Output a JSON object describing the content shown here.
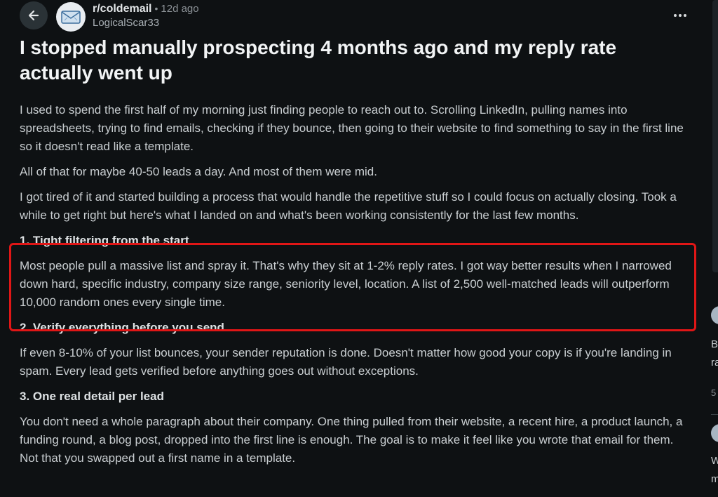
{
  "header": {
    "subreddit": "r/coldemail",
    "separator": "•",
    "time_ago": "12d ago",
    "author": "LogicalScar33",
    "back_icon": "arrow-left-icon",
    "more_icon": "more-horizontal-icon"
  },
  "post": {
    "title": "I stopped manually prospecting 4 months ago and my reply rate actually went up",
    "para1": "I used to spend the first half of my morning just finding people to reach out to. Scrolling LinkedIn, pulling names into spreadsheets, trying to find emails, checking if they bounce, then going to their website to find something to say in the first line so it doesn't read like a template.",
    "para2": "All of that for maybe 40-50 leads a day. And most of them were mid.",
    "para3": "I got tired of it and started building a process that would handle the repetitive stuff so I could focus on actually closing. Took a while to get right but here's what I landed on and what's been working consistently for the last few months.",
    "section1": {
      "heading": "1. Tight filtering from the start",
      "text": "Most people pull a massive list and spray it. That's why they sit at 1-2% reply rates. I got way better results when I narrowed down hard, specific industry, company size range, seniority level, location. A list of 2,500 well-matched leads will outperform 10,000 random ones every single time."
    },
    "section2": {
      "heading": "2. Verify everything before you send",
      "text": "If even 8-10% of your list bounces, your sender reputation is done. Doesn't matter how good your copy is if you're landing in spam. Every lead gets verified before anything goes out without exceptions."
    },
    "section3": {
      "heading": "3. One real detail per lead",
      "text": "You don't need a whole paragraph about their company. One thing pulled from their website, a recent hire, a product launch, a funding round, a blog post, dropped into the first line is enough. The goal is to make it feel like you wrote that email for them. Not that you swapped out a first name in a template."
    }
  },
  "sidebar_peek": {
    "item1_line1": "B",
    "item1_line2": "ra",
    "item1_meta": "5",
    "item2_line1": "W",
    "item2_line2": "m"
  },
  "colors": {
    "background": "#0e1113",
    "highlight_border": "#e01616"
  }
}
